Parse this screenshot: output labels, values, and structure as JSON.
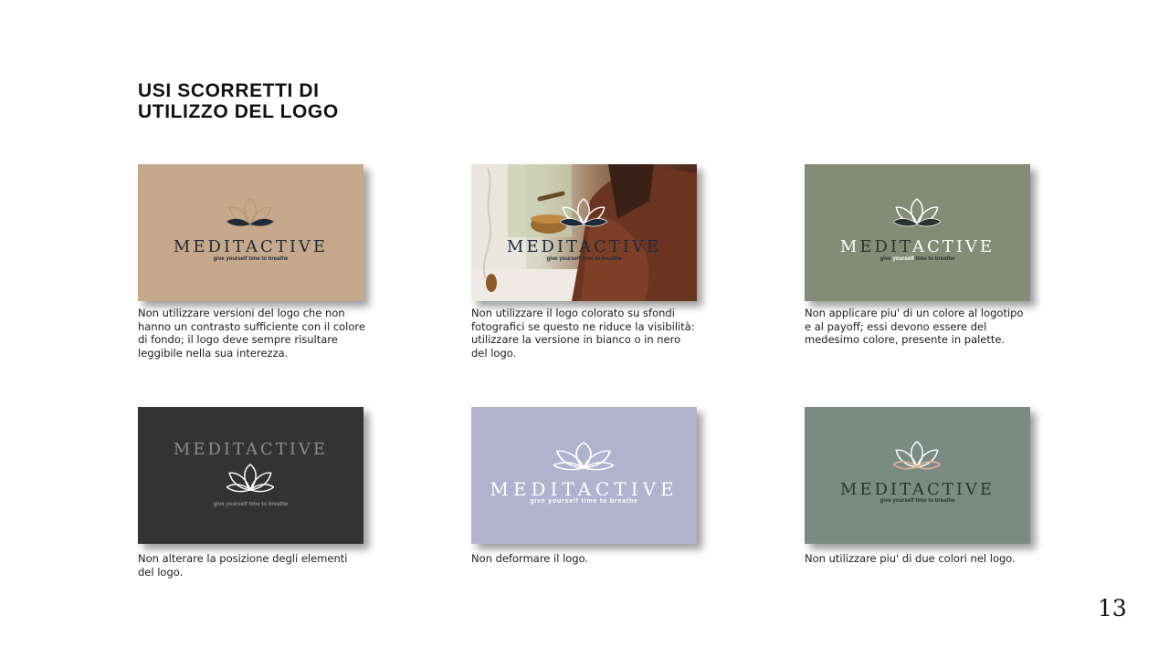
{
  "title": {
    "line1": "USI SCORRETTI DI",
    "line2": "UTILIZZO DEL LOGO"
  },
  "logo": {
    "wordmark": "MEDITACTIVE",
    "wordmark_colored_part_1": "M",
    "wordmark_colored_part_2": "EDIT",
    "wordmark_colored_part_3": "ACTIVE",
    "tagline": "give yourself time to breathe",
    "tagline_part_1": "give ",
    "tagline_part_2": "yourself",
    "tagline_part_3": " time to breathe"
  },
  "cards": [
    {
      "background": "#c6a98b",
      "caption": "Non utilizzare versioni del logo che non hanno un contrasto sufficiente con il colore di fondo; il logo deve sempre risultare leggibile nella sua interezza."
    },
    {
      "background": "#5a3a2a",
      "caption": "Non utilizzare il logo colorato su sfondi fotografici se questo ne riduce la visibilità: utilizzare la versione in bianco o in nero del logo."
    },
    {
      "background": "#848c76",
      "caption": "Non applicare piu' di un colore al logotipo e al payoff; essi devono essere del medesimo colore, presente in palette."
    },
    {
      "background": "#333333",
      "caption": "Non alterare la posizione degli elementi del logo."
    },
    {
      "background": "#b0b3cd",
      "caption": "Non deformare il logo."
    },
    {
      "background": "#7a8b84",
      "caption": "Non utilizzare piu' di due colori nel logo."
    }
  ],
  "colors": {
    "dark_navy": "#1e2a3a",
    "white": "#ffffff",
    "light_gray": "#8c8c8c",
    "dark_green": "#2b352d",
    "peach": "#d7ab8f"
  },
  "page_number": "13"
}
